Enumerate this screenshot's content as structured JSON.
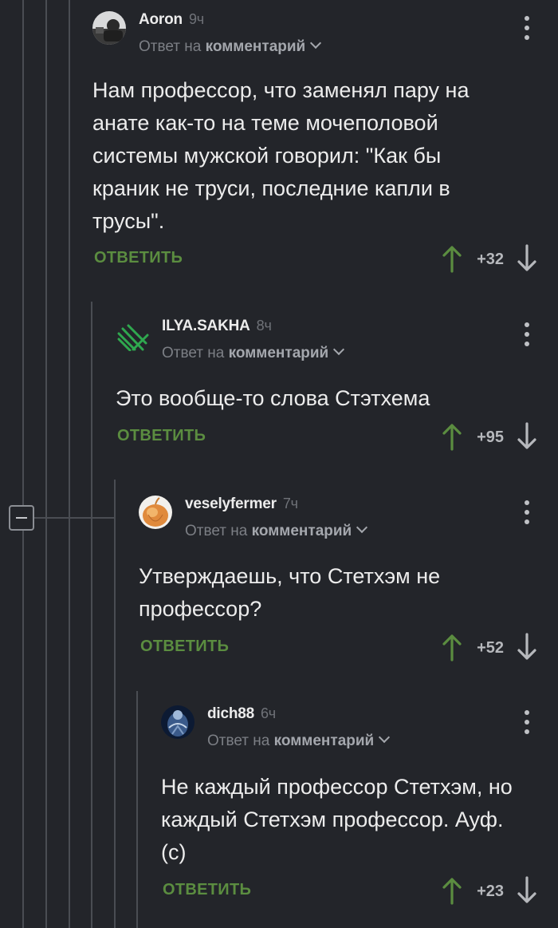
{
  "labels": {
    "reply_prefix": "Ответ на",
    "reply_target": "комментарий",
    "reply_action": "ОТВЕТИТЬ"
  },
  "colors": {
    "background": "#23252a",
    "reply_action": "#5b8d40",
    "thread_line": "#4a4d53"
  },
  "comments": [
    {
      "author": "Aoron",
      "time": "9ч",
      "text": "Нам профессор, что заменял пару на\nанате как-то на теме мочеполовой\nсистемы мужской говорил: \"Как бы\nкраник не труси, последние капли в\nтрусы\".",
      "score": "+32"
    },
    {
      "author": "ILYA.SAKHA",
      "time": "8ч",
      "text": "Это вообще-то слова Стэтхема",
      "score": "+95"
    },
    {
      "author": "veselyfermer",
      "time": "7ч",
      "text": "Утверждаешь, что Стетхэм не\nпрофессор?",
      "score": "+52"
    },
    {
      "author": "dich88",
      "time": "6ч",
      "text": "Не каждый профессор Стетхэм, но\nкаждый Стетхэм профессор. Ауф.\n(с)",
      "score": "+23"
    }
  ]
}
